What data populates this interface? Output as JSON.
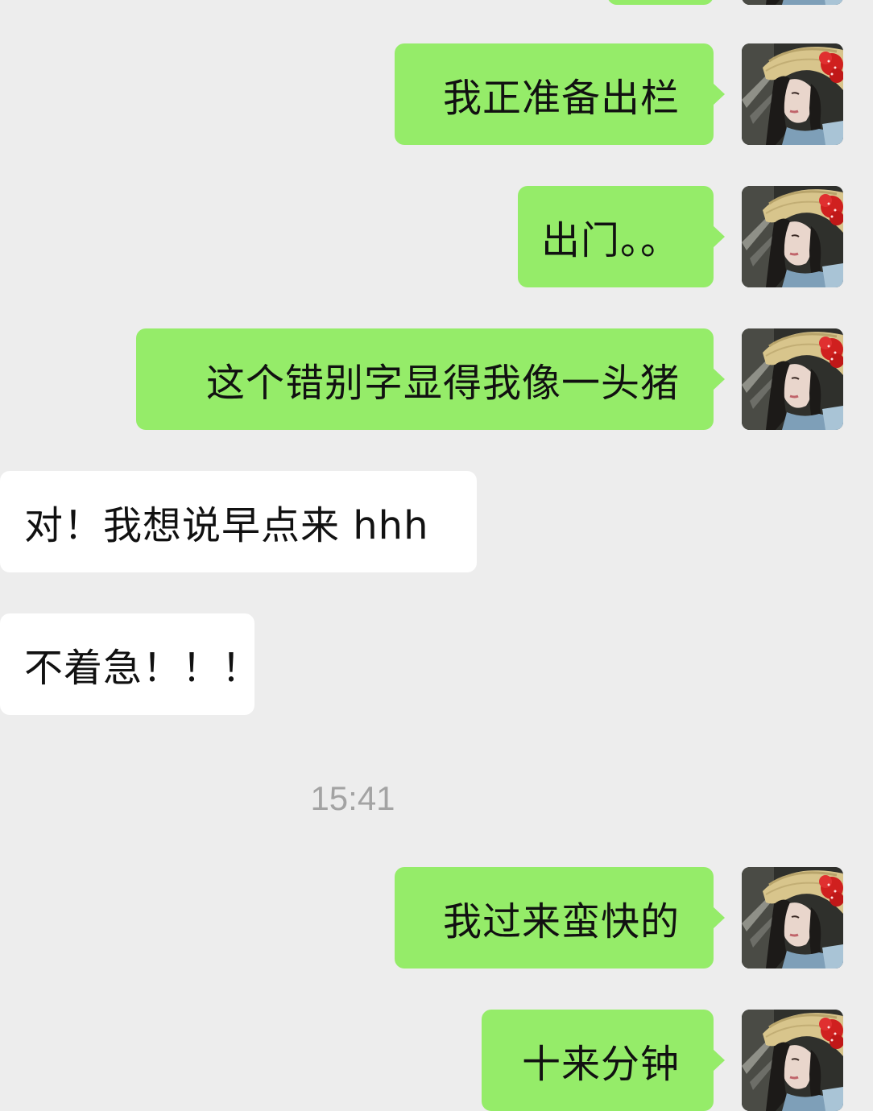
{
  "messages": [
    {
      "side": "out",
      "text": "我正准备出栏"
    },
    {
      "side": "out",
      "text": "出门。。"
    },
    {
      "side": "out",
      "text": "这个错别字显得我像一头猪"
    },
    {
      "side": "in",
      "text": "对！我想说早点来 hhh"
    },
    {
      "side": "in",
      "text": "不着急！！！"
    },
    {
      "side": "out",
      "text": "我过来蛮快的"
    },
    {
      "side": "out",
      "text": "十来分钟"
    }
  ],
  "timestamp": "15:41",
  "colors": {
    "background": "#ededed",
    "outgoing_bubble": "#95ec69",
    "incoming_bubble": "#ffffff",
    "timestamp_text": "#a3a3a3"
  },
  "icons": {
    "avatar": "user-avatar-photo"
  }
}
